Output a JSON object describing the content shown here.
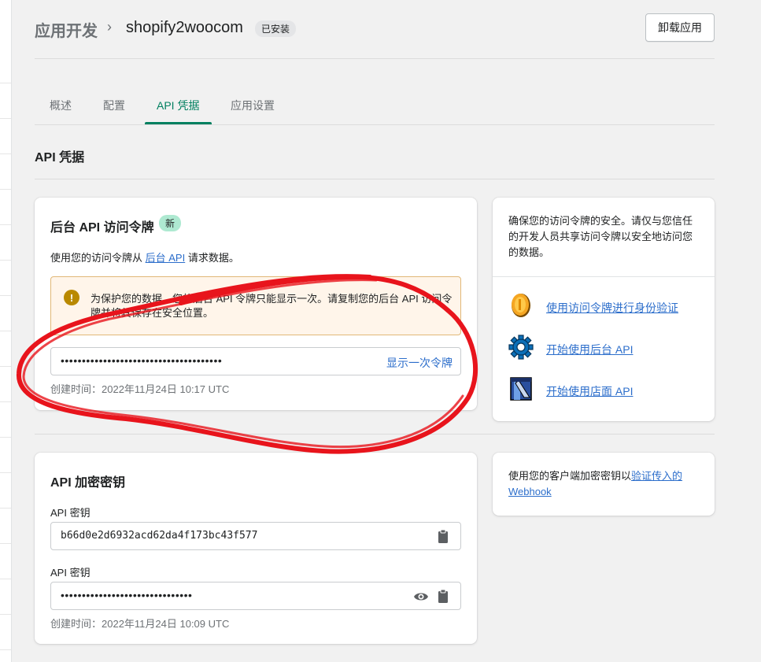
{
  "header": {
    "breadcrumb_root": "应用开发",
    "breadcrumb_separator": "›",
    "app_name": "shopify2woocom",
    "status_badge": "已安装",
    "uninstall_label": "卸载应用"
  },
  "tabs": [
    {
      "label": "概述",
      "active": false
    },
    {
      "label": "配置",
      "active": false
    },
    {
      "label": "API 凭据",
      "active": true
    },
    {
      "label": "应用设置",
      "active": false
    }
  ],
  "section_title": "API 凭据",
  "admin_token_card": {
    "title": "后台 API 访问令牌",
    "new_badge": "新",
    "desc_prefix": "使用您的访问令牌从",
    "desc_link": "后台 API",
    "desc_suffix": "请求数据。",
    "warning": "为保护您的数据，您的后台 API 令牌只能显示一次。请复制您的后台 API 访问令牌并将其保存在安全位置。",
    "token_masked": "••••••••••••••••••••••••••••••••••••••",
    "show_once_label": "显示一次令牌",
    "created": "创建时间：2022年11月24日 10:17 UTC"
  },
  "security_side_card": {
    "text": "确保您的访问令牌的安全。请仅与您信任的开发人员共享访问令牌以安全地访问您的数据。",
    "links": [
      {
        "label": "使用访问令牌进行身份验证",
        "icon": "coin-icon"
      },
      {
        "label": "开始使用后台 API",
        "icon": "gear-icon"
      },
      {
        "label": "开始使用店面 API",
        "icon": "storefront-icon"
      }
    ]
  },
  "secret_key_card": {
    "title": "API 加密密钥",
    "api_key_label": "API 密钥",
    "api_key_value": "b66d0e2d6932acd62da4f173bc43f577",
    "api_secret_label": "API 密钥",
    "api_secret_masked": "•••••••••••••••••••••••••••••••",
    "created": "创建时间：2022年11月24日 10:09 UTC"
  },
  "webhook_side_card": {
    "text_prefix": "使用您的客户端加密密钥以",
    "text_link": "验证传入的 Webhook"
  },
  "colors": {
    "accent_green": "#008060",
    "link_blue": "#2c6ecb",
    "warning_bg": "#fff5ea",
    "annotation_red": "#e8141c"
  }
}
